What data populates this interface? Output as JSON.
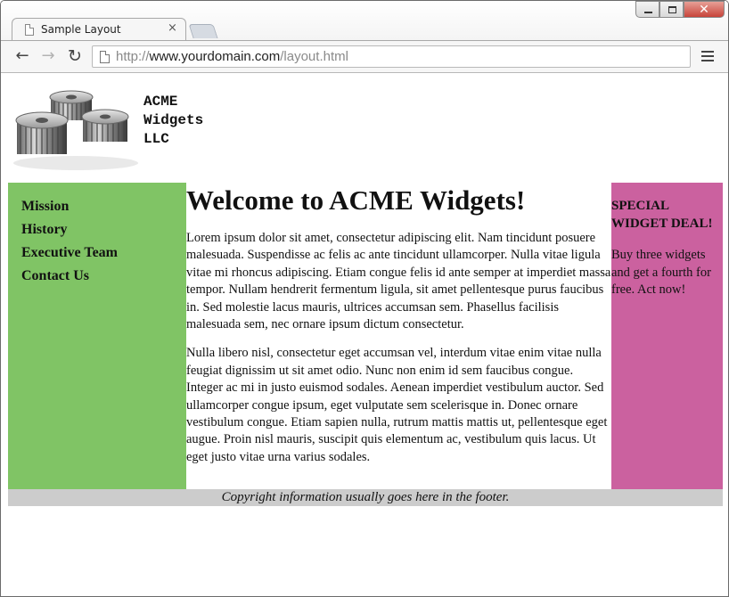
{
  "browser": {
    "tab_title": "Sample Layout",
    "tab_close": "×",
    "url_scheme": "http://",
    "url_host": "www.yourdomain.com",
    "url_path": "/layout.html",
    "back_icon": "←",
    "forward_icon": "→",
    "reload_icon": "↻",
    "close_glyph": "✕"
  },
  "header": {
    "logo_lines": [
      "ACME",
      "Widgets",
      "LLC"
    ]
  },
  "nav": {
    "items": [
      "Mission",
      "History",
      "Executive Team",
      "Contact Us"
    ]
  },
  "main": {
    "heading": "Welcome to ACME Widgets!",
    "paragraphs": [
      "Lorem ipsum dolor sit amet, consectetur adipiscing elit. Nam tincidunt posuere malesuada. Suspendisse ac felis ac ante tincidunt ullamcorper. Nulla vitae ligula vitae mi rhoncus adipiscing. Etiam congue felis id ante semper at imperdiet massa tempor. Nullam hendrerit fermentum ligula, sit amet pellentesque purus faucibus in. Sed molestie lacus mauris, ultrices accumsan sem. Phasellus facilisis malesuada sem, nec ornare ipsum dictum consectetur.",
      "Nulla libero nisl, consectetur eget accumsan vel, interdum vitae enim vitae nulla feugiat dignissim ut sit amet odio. Nunc non enim id sem faucibus congue. Integer ac mi in justo euismod sodales. Aenean imperdiet vestibulum auctor. Sed ullamcorper congue ipsum, eget vulputate sem scelerisque in. Donec ornare vestibulum congue. Etiam sapien nulla, rutrum mattis mattis ut, pellentesque eget augue. Proin nisl mauris, suscipit quis elementum ac, vestibulum quis lacus. Ut eget justo vitae urna varius sodales."
    ]
  },
  "sidebar": {
    "heading": "SPECIAL WIDGET DEAL!",
    "text": "Buy three widgets and get a fourth for free. Act now!"
  },
  "footer": {
    "text": "Copyright information usually goes here in the footer."
  },
  "colors": {
    "nav_bg": "#80c465",
    "sidebar_bg": "#cb619f",
    "footer_bg": "#cccccc"
  },
  "icons": {
    "tab": "document-icon",
    "gears": "gears-logo-icon",
    "menu": "hamburger-menu-icon"
  }
}
